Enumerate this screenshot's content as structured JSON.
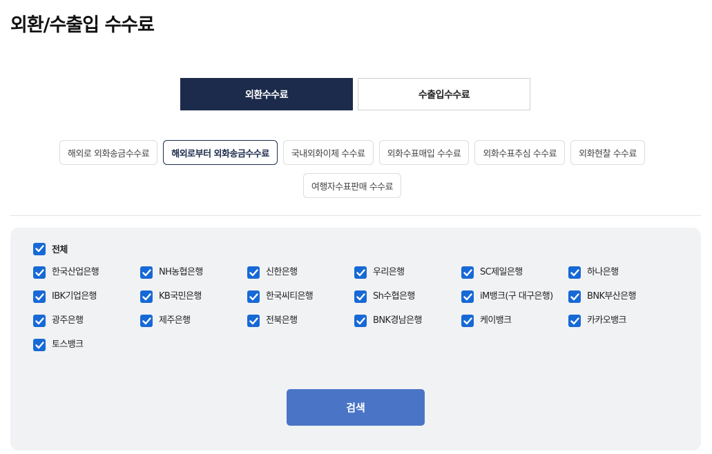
{
  "page": {
    "title": "외환/수출입 수수료"
  },
  "main_tabs": [
    {
      "label": "외환수수료",
      "active": true
    },
    {
      "label": "수출입수수료",
      "active": false
    }
  ],
  "sub_tabs": [
    {
      "label": "해외로 외화송금수수료",
      "active": false
    },
    {
      "label": "해외로부터 외화송금수수료",
      "active": true
    },
    {
      "label": "국내외화이체 수수료",
      "active": false
    },
    {
      "label": "외화수표매입 수수료",
      "active": false
    },
    {
      "label": "외화수표추심 수수료",
      "active": false
    },
    {
      "label": "외화현찰 수수료",
      "active": false
    },
    {
      "label": "여행자수표판매 수수료",
      "active": false
    }
  ],
  "filter": {
    "all": {
      "label": "전체",
      "checked": true
    },
    "banks": [
      {
        "label": "한국산업은행",
        "checked": true
      },
      {
        "label": "NH농협은행",
        "checked": true
      },
      {
        "label": "신한은행",
        "checked": true
      },
      {
        "label": "우리은행",
        "checked": true
      },
      {
        "label": "SC제일은행",
        "checked": true
      },
      {
        "label": "하나은행",
        "checked": true
      },
      {
        "label": "IBK기업은행",
        "checked": true
      },
      {
        "label": "KB국민은행",
        "checked": true
      },
      {
        "label": "한국씨티은행",
        "checked": true
      },
      {
        "label": "Sh수협은행",
        "checked": true
      },
      {
        "label": "iM뱅크(구 대구은행)",
        "checked": true
      },
      {
        "label": "BNK부산은행",
        "checked": true
      },
      {
        "label": "광주은행",
        "checked": true
      },
      {
        "label": "제주은행",
        "checked": true
      },
      {
        "label": "전북은행",
        "checked": true
      },
      {
        "label": "BNK경남은행",
        "checked": true
      },
      {
        "label": "케이뱅크",
        "checked": true
      },
      {
        "label": "카카오뱅크",
        "checked": true
      },
      {
        "label": "토스뱅크",
        "checked": true
      }
    ],
    "search_label": "검색"
  },
  "colors": {
    "active_tab": "#1c2b4b",
    "checkbox": "#1769d6",
    "search_button": "#4a75c7",
    "panel_bg": "#f1f2f4"
  },
  "icons": {
    "checkbox": "checkmark-icon"
  }
}
